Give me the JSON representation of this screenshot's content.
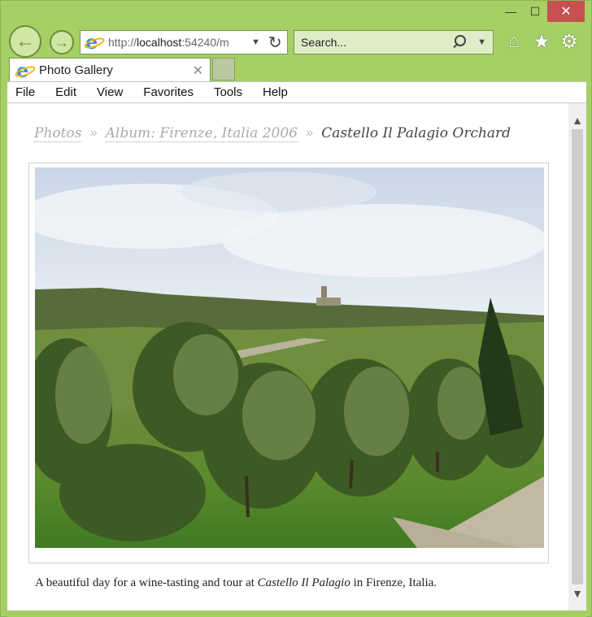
{
  "window": {
    "minimize_icon": "—",
    "maximize_icon": "☐",
    "close_icon": "✕"
  },
  "nav": {
    "back_icon": "←",
    "forward_icon": "→",
    "address_prefix": "http://",
    "address_host": "localhost",
    "address_rest": ":54240/m",
    "search_placeholder": "Search...",
    "home_icon": "⌂",
    "favorites_icon": "★",
    "tools_icon": "⚙"
  },
  "tabs": [
    {
      "label": "Photo Gallery",
      "close_icon": "✕"
    }
  ],
  "menu": [
    "File",
    "Edit",
    "View",
    "Favorites",
    "Tools",
    "Help"
  ],
  "breadcrumb": {
    "items": [
      "Photos",
      "Album: Firenze, Italia 2006"
    ],
    "separator": "»",
    "current": "Castello Il Palagio Orchard"
  },
  "caption": {
    "before": "A beautiful day for a wine-tasting and tour at ",
    "emphasis": "Castello Il Palagio",
    "after": " in Firenze, Italia."
  },
  "colors": {
    "chrome": "#a6cf65",
    "close_button": "#c75050",
    "breadcrumb_link": "#aaaaaa"
  }
}
